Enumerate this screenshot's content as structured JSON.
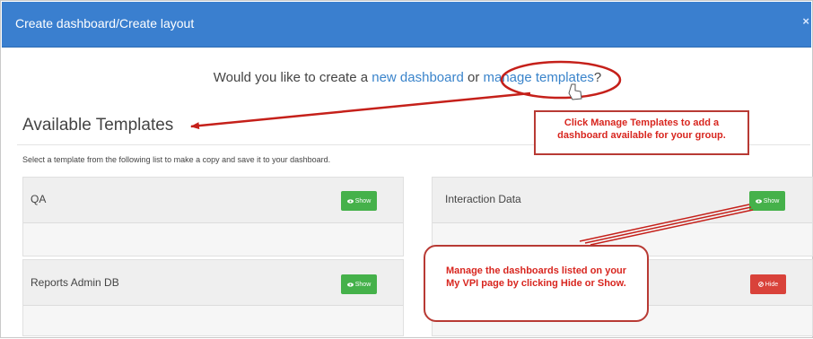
{
  "modal": {
    "title": "Create dashboard/Create layout",
    "close_glyph": "×"
  },
  "prompt": {
    "before": "Would you like to create a ",
    "new_dashboard_link": "new dashboard",
    "middle": " or ",
    "manage_templates_link": "manage templates",
    "after": "?"
  },
  "templates": {
    "heading": "Available Templates",
    "instructions": "Select a template from the following list to make a copy and save it to your dashboard.",
    "items": [
      {
        "title": "QA",
        "button_label": "Show",
        "button_icon": "eye-icon"
      },
      {
        "title": "Interaction Data",
        "button_label": "Show",
        "button_icon": "eye-icon"
      },
      {
        "title": "Reports Admin DB",
        "button_label": "Show",
        "button_icon": "eye-icon"
      },
      {
        "title": "",
        "button_label": "Hide",
        "button_icon": "ban-icon"
      }
    ]
  },
  "annotations": {
    "callout_top": "Click Manage Templates to add a dashboard available for your group.",
    "callout_bottom": "Manage the dashboards listed on your My VPI page by clicking Hide or Show."
  },
  "colors": {
    "header": "#3a7fcf",
    "link": "#3a84cb",
    "show_button": "#45b14a",
    "hide_button": "#d9423a",
    "annotation": "#b83a34"
  }
}
